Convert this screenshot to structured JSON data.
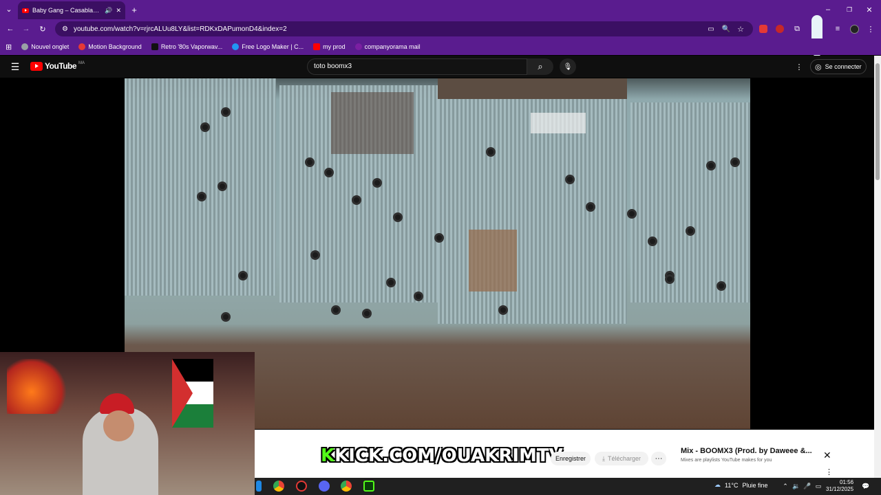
{
  "browser": {
    "tab_title": "Baby Gang – Casablanca (ft",
    "url": "youtube.com/watch?v=rjrcALUu8LY&list=RDKxDAPumonD4&index=2",
    "bookmarks": [
      {
        "label": "Nouvel onglet",
        "color": "#9aa0a6"
      },
      {
        "label": "Motion Background",
        "color": "#e53935"
      },
      {
        "label": "Retro '80s Vaporwav...",
        "color": "#111111"
      },
      {
        "label": "Free Logo Maker | C...",
        "color": "#2196f3"
      },
      {
        "label": "my prod",
        "color": "#ff0000"
      },
      {
        "label": "companyorama mail",
        "color": "#7b1fa2"
      }
    ]
  },
  "youtube": {
    "logo_text": "YouTube",
    "region": "MA",
    "search_value": "toto boomx3",
    "signin_label": "Se connecter"
  },
  "overlay": {
    "kick_k": "K",
    "kick_text": "KICK.COM/OUAKRIMTV"
  },
  "actions": {
    "save_label": "Enregistrer",
    "download_label": "Télécharger",
    "more_label": "···"
  },
  "mix": {
    "title": "Mix - BOOMX3 (Prod. by Daweee &...",
    "subtitle": "Mixes are playlists YouTube makes for you"
  },
  "taskbar": {
    "temperature": "11°C",
    "weather": "Pluie fine",
    "time": "01:56",
    "date": "31/12/2025"
  },
  "colors": {
    "chrome_accent": "#5a1c8f",
    "youtube_red": "#ff0000",
    "kick_green": "#53fc18"
  }
}
